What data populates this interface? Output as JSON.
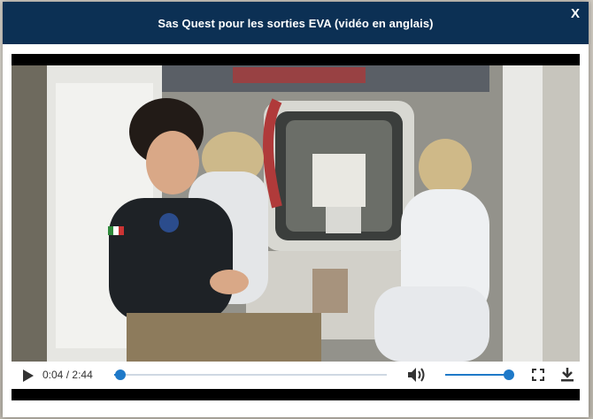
{
  "modal": {
    "title": "Sas Quest pour les sorties EVA  (vidéo en anglais)",
    "close_label": "X"
  },
  "player": {
    "current_time": "0:04",
    "separator": "/",
    "duration": "2:44",
    "progress_fraction": 0.024,
    "volume_fraction": 1.0
  },
  "icons": {
    "play": "play-icon",
    "volume": "speaker-icon",
    "fullscreen": "fullscreen-icon",
    "download": "download-icon"
  },
  "colors": {
    "header_bg": "#0c3054",
    "accent": "#1e79c8"
  }
}
